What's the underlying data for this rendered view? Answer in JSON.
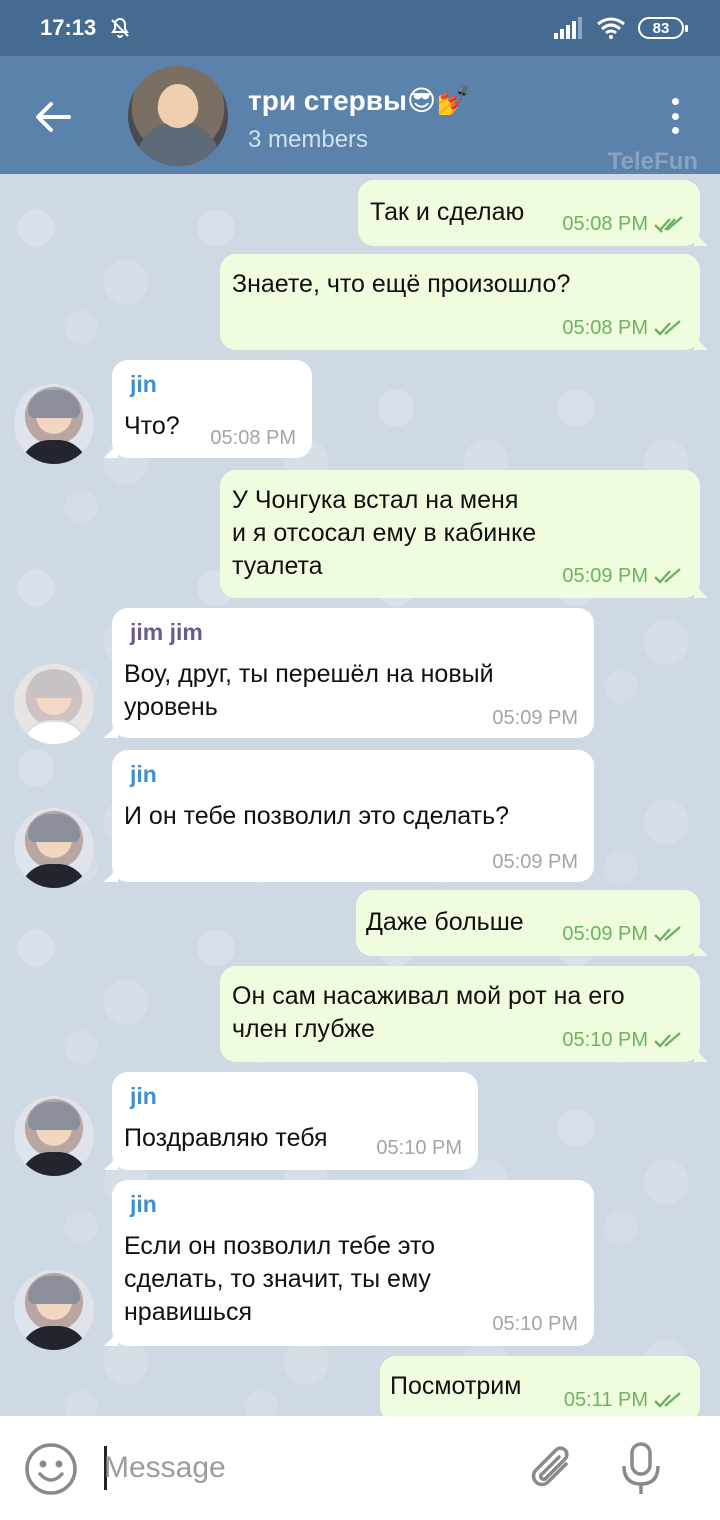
{
  "status_bar": {
    "time": "17:13",
    "battery": "83",
    "icons": [
      "bell-off-icon",
      "signal-icon",
      "wifi-icon",
      "battery-icon"
    ]
  },
  "header": {
    "title": "три стервы😎💅",
    "subtitle": "3 members",
    "watermark": "TeleFun",
    "icons": [
      "back-arrow-icon",
      "more-vertical-icon"
    ]
  },
  "messages": [
    {
      "direction": "out",
      "text": "Так и сделаю",
      "time": "05:08 PM",
      "status": "read"
    },
    {
      "direction": "out",
      "text": "Знаете, что ещё произошло?",
      "time": "05:08 PM",
      "status": "read"
    },
    {
      "direction": "in",
      "sender": "jin",
      "text": "Что?",
      "time": "05:08 PM"
    },
    {
      "direction": "out",
      "text": "У Чонгука встал на меня\nи я отсосал ему в кабинке\nтуалета",
      "time": "05:09 PM",
      "status": "read"
    },
    {
      "direction": "in",
      "sender": "jim jim",
      "text": "Воу, друг, ты перешёл на новый\nуровень",
      "time": "05:09 PM"
    },
    {
      "direction": "in",
      "sender": "jin",
      "text": "И он тебе позволил это сделать?",
      "time": "05:09 PM"
    },
    {
      "direction": "out",
      "text": "Даже больше",
      "time": "05:09 PM",
      "status": "read"
    },
    {
      "direction": "out",
      "text": "Он сам насаживал мой рот на его\nчлен глубже",
      "time": "05:10 PM",
      "status": "read"
    },
    {
      "direction": "in",
      "sender": "jin",
      "text": "Поздравляю тебя",
      "time": "05:10 PM"
    },
    {
      "direction": "in",
      "sender": "jin",
      "text": "Если он позволил тебе это\nсделать, то значит, ты ему\nнравишься",
      "time": "05:10 PM"
    },
    {
      "direction": "out",
      "text": "Посмотрим",
      "time": "05:11 PM",
      "status": "read"
    }
  ],
  "input": {
    "placeholder": "Message",
    "icons": [
      "emoji-icon",
      "attach-icon",
      "microphone-icon"
    ]
  },
  "colors": {
    "status_bar": "#456b90",
    "header": "#5a82ab",
    "outgoing_bubble": "#effdde",
    "incoming_bubble": "#ffffff",
    "check_marks": "#6db35f",
    "sender_jin": "#3e8fd0",
    "sender_jimjim": "#6c5a8a"
  }
}
